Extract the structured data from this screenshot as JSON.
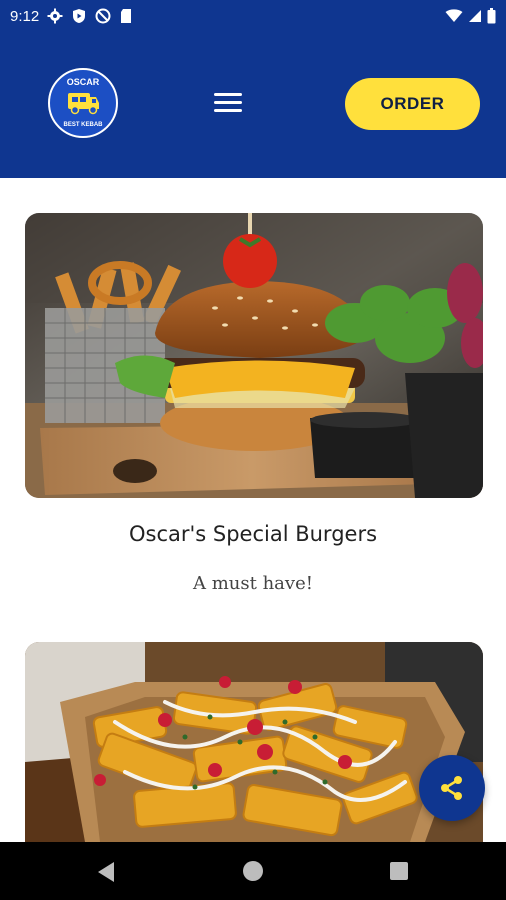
{
  "status_bar": {
    "time": "9:12",
    "icons": [
      "gear-icon",
      "play-protect-icon",
      "no-sim-icon",
      "sd-card-icon"
    ],
    "right_icons": [
      "wifi-icon",
      "signal-icon",
      "battery-icon"
    ]
  },
  "header": {
    "logo": {
      "top_text": "OSCAR",
      "bottom_text": "BEST KEBAB"
    },
    "order_label": "ORDER"
  },
  "menu_items": [
    {
      "title": "Oscar's Special Burgers",
      "subtitle": "A must have!",
      "image": "burger-photo"
    },
    {
      "title": "",
      "subtitle": "",
      "image": "loaded-fries-photo"
    }
  ],
  "colors": {
    "primary": "#0f3690",
    "accent": "#ffe03c",
    "background": "#ffffff"
  }
}
